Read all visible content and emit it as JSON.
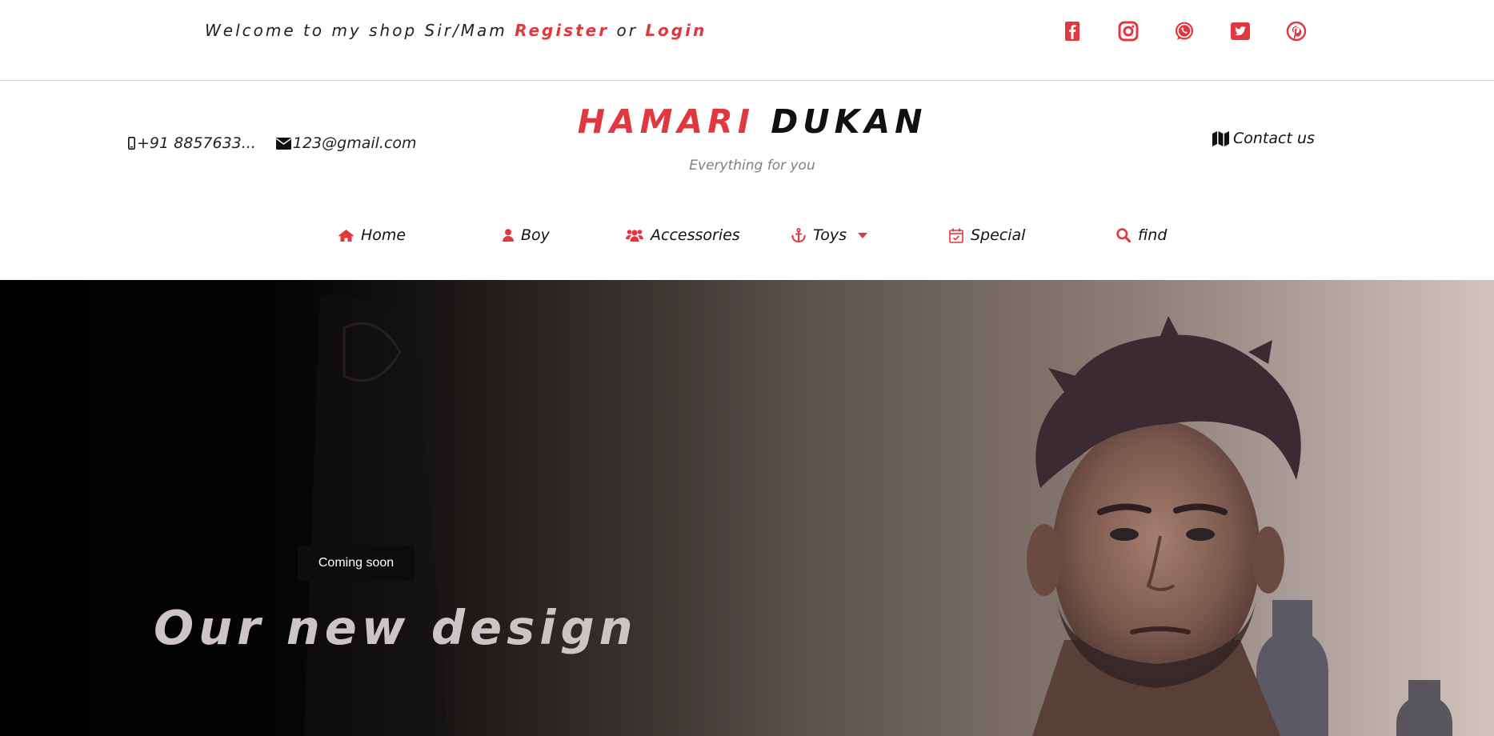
{
  "topbar": {
    "welcome_text": "Welcome to my shop Sir/Mam",
    "register_label": "Register",
    "or_text": "or",
    "login_label": "Login",
    "socials": [
      "facebook-icon",
      "instagram-icon",
      "whatsapp-icon",
      "twitter-icon",
      "pinterest-icon"
    ]
  },
  "header": {
    "phone": "+91 8857633...",
    "email": "123@gmail.com",
    "brand_first": "HAMARI",
    "brand_second": "DUKAN",
    "tagline": "Everything for you",
    "contact_label": "Contact us"
  },
  "nav": {
    "home": "Home",
    "boy": "Boy",
    "accessories": "Accessories",
    "toys": "Toys",
    "special": "Special",
    "find": "find"
  },
  "hero": {
    "badge": "Coming soon",
    "title": "Our new design"
  },
  "colors": {
    "accent": "#e0383e",
    "text": "#111111",
    "muted": "#808080"
  }
}
